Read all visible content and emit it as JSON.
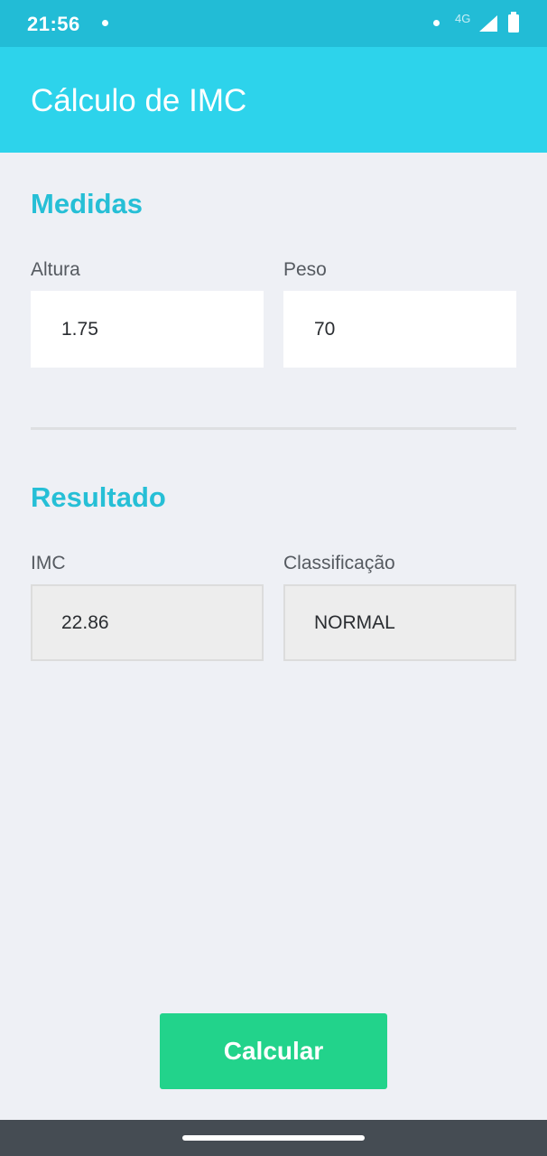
{
  "status_bar": {
    "time": "21:56",
    "network": "4G"
  },
  "app_bar": {
    "title": "Cálculo de IMC"
  },
  "medidas": {
    "title": "Medidas",
    "altura": {
      "label": "Altura",
      "value": "1.75"
    },
    "peso": {
      "label": "Peso",
      "value": "70"
    }
  },
  "resultado": {
    "title": "Resultado",
    "imc": {
      "label": "IMC",
      "value": "22.86"
    },
    "classificacao": {
      "label": "Classificação",
      "value": "NORMAL"
    }
  },
  "actions": {
    "calcular_label": "Calcular"
  },
  "colors": {
    "status_bar": "#22bcd6",
    "app_bar": "#2dd3eb",
    "accent_title": "#26bfd6",
    "button": "#22d38b",
    "background": "#eef0f5"
  }
}
